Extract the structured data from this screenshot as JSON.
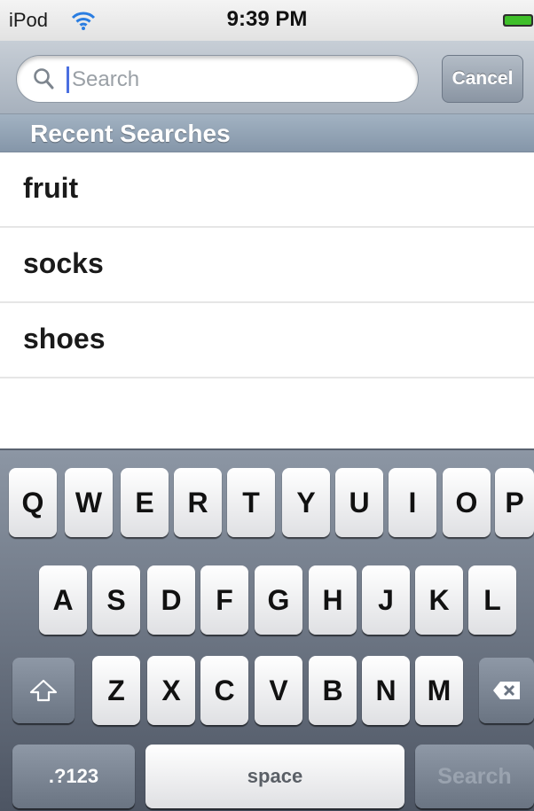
{
  "status_bar": {
    "carrier": "iPod",
    "time": "9:39 PM",
    "wifi_icon": "wifi-icon",
    "battery_icon": "battery-icon",
    "battery_color": "#3fbf2a"
  },
  "search": {
    "placeholder": "Search",
    "value": "",
    "cancel_label": "Cancel",
    "icon": "search-icon"
  },
  "recent": {
    "header": "Recent Searches",
    "items": [
      "fruit",
      "socks",
      "shoes"
    ]
  },
  "keyboard": {
    "rows": [
      [
        "Q",
        "W",
        "E",
        "R",
        "T",
        "Y",
        "U",
        "I",
        "O",
        "P"
      ],
      [
        "A",
        "S",
        "D",
        "F",
        "G",
        "H",
        "J",
        "K",
        "L"
      ],
      [
        "Z",
        "X",
        "C",
        "V",
        "B",
        "N",
        "M"
      ]
    ],
    "shift_icon": "shift-icon",
    "backspace_icon": "backspace-icon",
    "numbers_label": ".?123",
    "space_label": "space",
    "search_label": "Search"
  }
}
